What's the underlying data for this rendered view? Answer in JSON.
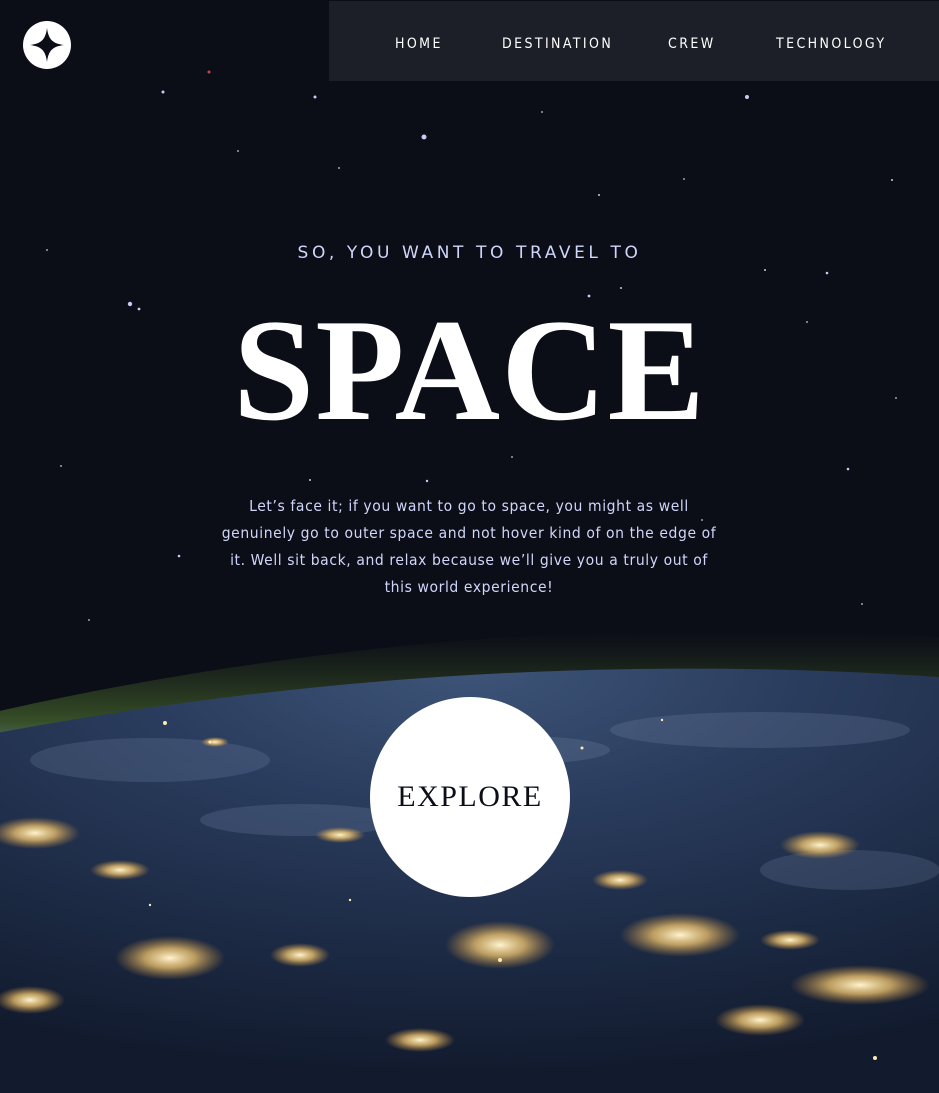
{
  "header": {
    "logo_icon": "star-logo-icon",
    "nav_items": [
      {
        "label": "HOME"
      },
      {
        "label": "DESTINATION"
      },
      {
        "label": "CREW"
      },
      {
        "label": "TECHNOLOGY"
      }
    ]
  },
  "hero": {
    "subtitle": "SO, YOU WANT TO TRAVEL TO",
    "title": "SPACE",
    "description": "Let’s face it; if you want to go to space, you might as well genuinely go to outer space and not hover kind of on the edge of it. Well sit back, and relax because we’ll give you a truly out of this world experience!",
    "cta_label": "EXPLORE"
  },
  "colors": {
    "background": "#0b0d17",
    "nav_background": "#1e202a",
    "text_light": "#d0d6f9",
    "white": "#ffffff"
  }
}
